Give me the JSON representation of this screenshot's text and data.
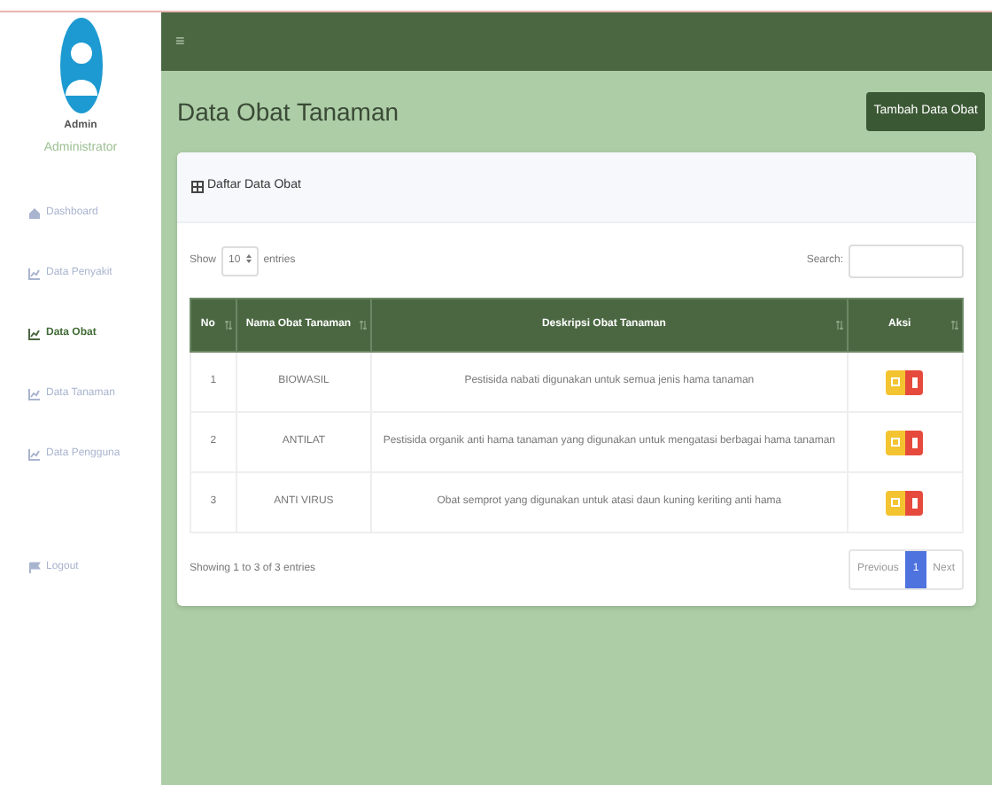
{
  "sidebar": {
    "user": {
      "name": "Admin",
      "role": "Administrator"
    },
    "items": [
      {
        "label": "Dashboard",
        "selected": false
      },
      {
        "label": "Data Penyakit",
        "selected": false
      },
      {
        "label": "Data Obat",
        "selected": true
      },
      {
        "label": "Data Tanaman",
        "selected": false
      },
      {
        "label": "Data Pengguna",
        "selected": false
      },
      {
        "label": "Logout",
        "selected": false
      }
    ]
  },
  "topbar": {
    "menu_icon": "≡"
  },
  "page": {
    "title": "Data Obat Tanaman",
    "add_button": "Tambah Data Obat"
  },
  "card": {
    "title": "Daftar Data Obat",
    "show": {
      "before": "Show",
      "value": "10",
      "after": "entries"
    },
    "search": {
      "label": "Search:"
    },
    "table": {
      "columns": [
        "No",
        "Nama Obat Tanaman",
        "Deskripsi Obat Tanaman",
        "Aksi"
      ],
      "rows": [
        {
          "no": "1",
          "name": "BIOWASIL",
          "description": "Pestisida nabati digunakan untuk semua jenis hama tanaman"
        },
        {
          "no": "2",
          "name": "ANTILAT",
          "description": "Pestisida organik anti hama tanaman yang digunakan untuk mengatasi berbagai hama tanaman"
        },
        {
          "no": "3",
          "name": "ANTI VIRUS",
          "description": "Obat semprot yang digunakan untuk atasi daun kuning keriting anti hama"
        }
      ]
    },
    "info": "Showing 1 to 3 of 3 entries",
    "pagination": [
      {
        "label": "Previous",
        "selected": false
      },
      {
        "label": "1",
        "selected": true
      },
      {
        "label": "Next",
        "selected": false
      }
    ]
  }
}
